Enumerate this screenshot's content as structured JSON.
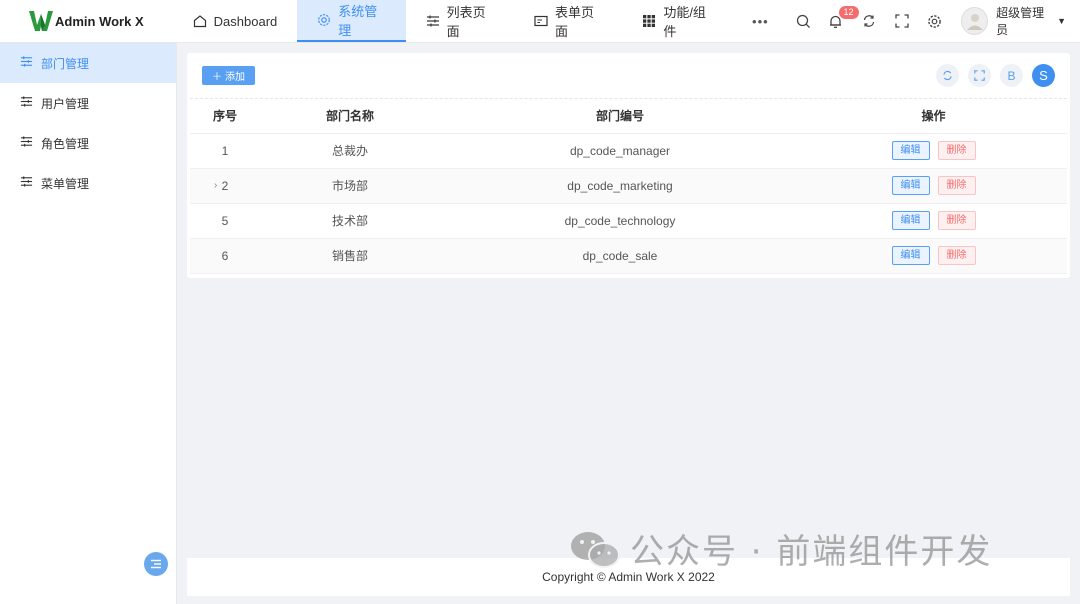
{
  "app": {
    "title": "Admin Work X"
  },
  "nav": {
    "items": [
      {
        "label": "Dashboard",
        "icon": "home-icon"
      },
      {
        "label": "系统管理",
        "icon": "gear-icon",
        "active": true
      },
      {
        "label": "列表页面",
        "icon": "sliders-icon"
      },
      {
        "label": "表单页面",
        "icon": "form-icon"
      },
      {
        "label": "功能/组件",
        "icon": "grid-icon"
      }
    ],
    "more": "•••"
  },
  "header": {
    "notification_count": "12",
    "user_name": "超级管理员"
  },
  "sidebar": {
    "items": [
      {
        "label": "部门管理",
        "active": true
      },
      {
        "label": "用户管理"
      },
      {
        "label": "角色管理"
      },
      {
        "label": "菜单管理"
      }
    ]
  },
  "toolbar": {
    "add_label": "添加",
    "circle_b": "B",
    "circle_s": "S"
  },
  "table": {
    "columns": [
      "序号",
      "部门名称",
      "部门编号",
      "操作"
    ],
    "rows": [
      {
        "index": "1",
        "name": "总裁办",
        "code": "dp_code_manager",
        "expandable": false
      },
      {
        "index": "2",
        "name": "市场部",
        "code": "dp_code_marketing",
        "expandable": true
      },
      {
        "index": "5",
        "name": "技术部",
        "code": "dp_code_technology",
        "expandable": false
      },
      {
        "index": "6",
        "name": "销售部",
        "code": "dp_code_sale",
        "expandable": false
      }
    ],
    "edit_label": "编辑",
    "delete_label": "删除"
  },
  "footer": {
    "copyright": "Copyright © Admin Work X 2022"
  },
  "watermark": {
    "text": "公众号 · 前端组件开发"
  },
  "colors": {
    "primary": "#3f8ff0",
    "danger": "#f56c6c",
    "active_bg": "#dbeafd"
  }
}
